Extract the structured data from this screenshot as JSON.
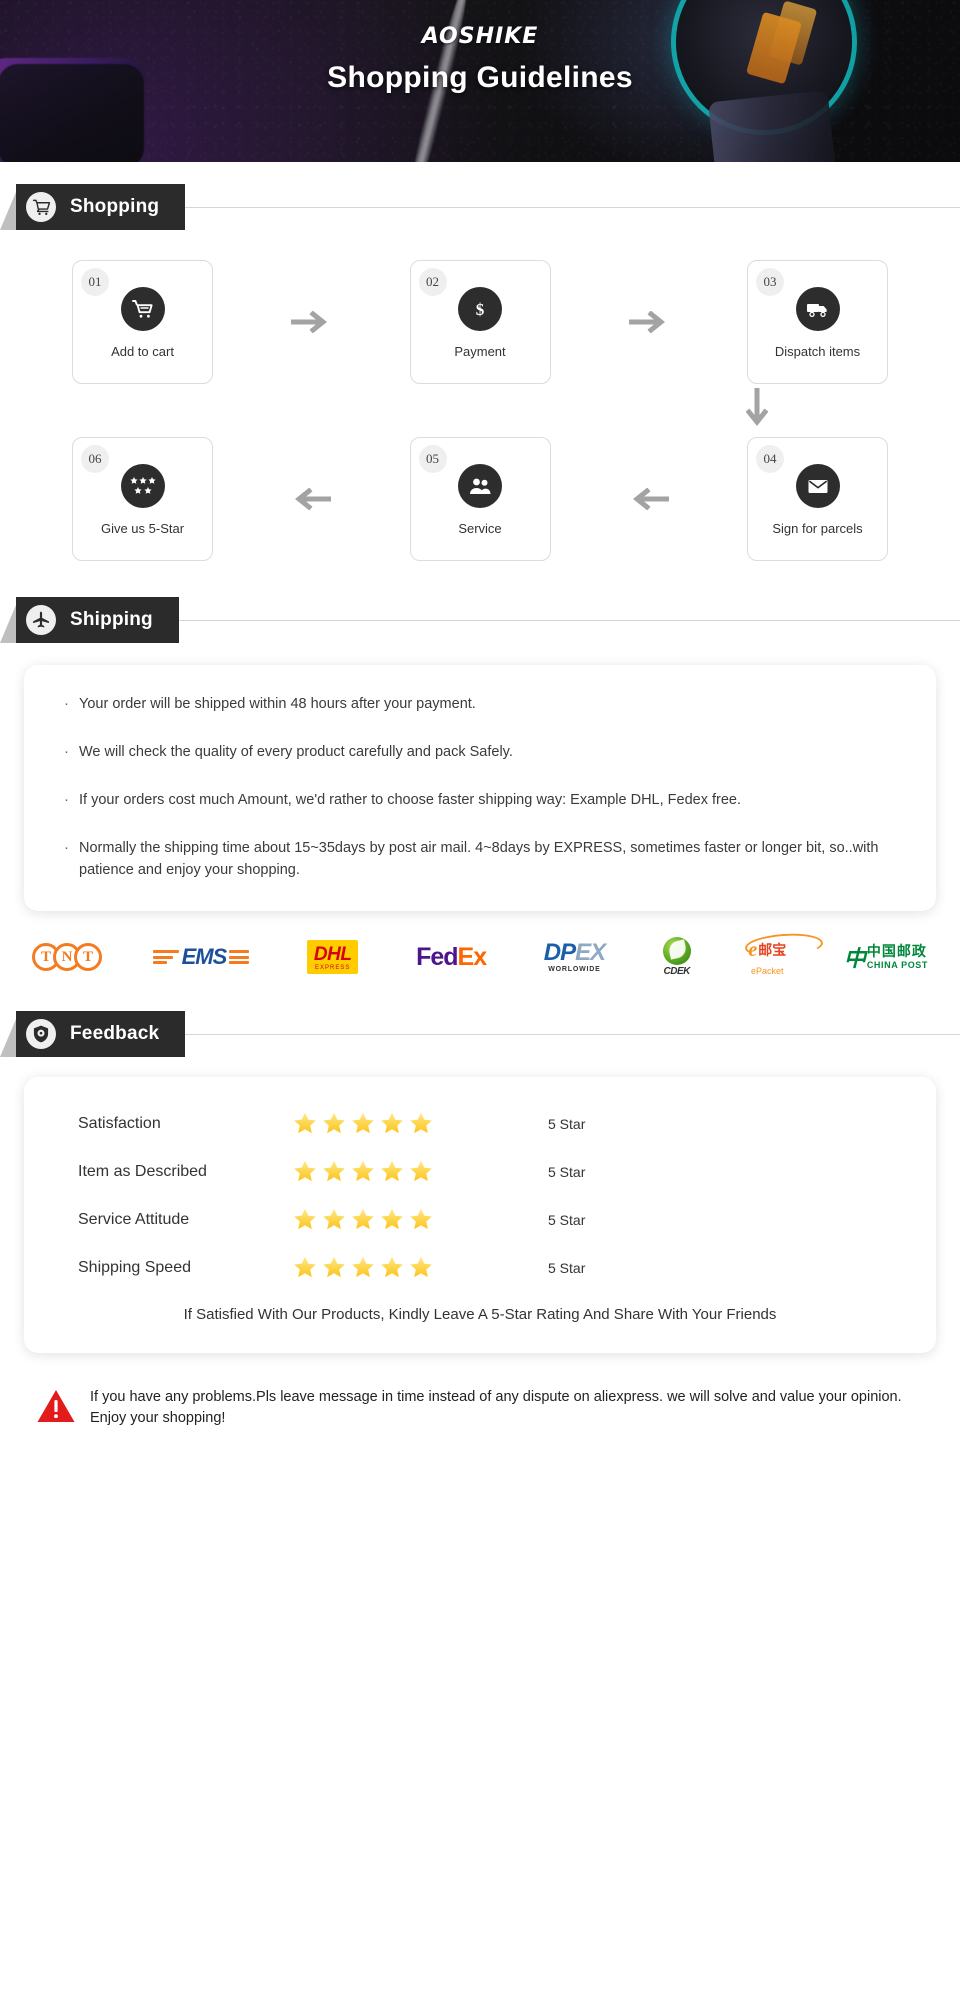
{
  "hero": {
    "brand": "AOSHIKE",
    "title": "Shopping Guidelines"
  },
  "sections": {
    "shopping": {
      "label": "Shopping",
      "icon": "shopping-cart-icon"
    },
    "shipping": {
      "label": "Shipping",
      "icon": "airplane-icon"
    },
    "feedback": {
      "label": "Feedback",
      "icon": "shield-icon"
    }
  },
  "steps": {
    "row1": [
      {
        "num": "01",
        "label": "Add to cart",
        "icon": "cart-icon"
      },
      {
        "num": "02",
        "label": "Payment",
        "icon": "dollar-icon"
      },
      {
        "num": "03",
        "label": "Dispatch items",
        "icon": "truck-icon"
      }
    ],
    "row2": [
      {
        "num": "06",
        "label": "Give us 5-Star",
        "icon": "stars-icon"
      },
      {
        "num": "05",
        "label": "Service",
        "icon": "people-icon"
      },
      {
        "num": "04",
        "label": "Sign for parcels",
        "icon": "envelope-icon"
      }
    ],
    "arrow_right": "→",
    "arrow_left": "←",
    "arrow_down": "↓"
  },
  "shipping_notes": [
    "Your order will be shipped within 48 hours after your payment.",
    "We will check the quality of every product carefully and pack Safely.",
    "If your orders cost much Amount, we'd rather to choose faster shipping way: Example DHL, Fedex free.",
    "Normally the shipping time about 15~35days by post air mail. 4~8days by EXPRESS, sometimes faster or longer bit, so..with patience and enjoy your shopping."
  ],
  "carriers": [
    {
      "name": "TNT",
      "letters": [
        "T",
        "N",
        "T"
      ]
    },
    {
      "name": "EMS",
      "text": "EMS"
    },
    {
      "name": "DHL",
      "text": "DHL",
      "sub": "EXPRESS"
    },
    {
      "name": "FedEx",
      "part1": "Fed",
      "part2": "Ex"
    },
    {
      "name": "DPEX",
      "part1": "DP",
      "part2": "EX",
      "sub": "WORLOWIDE"
    },
    {
      "name": "CDEK",
      "text": "CDEK"
    },
    {
      "name": "ePacket",
      "mark": "e",
      "cn": "邮宝",
      "sub": "ePacket"
    },
    {
      "name": "China Post",
      "cn": "中国邮政",
      "en": "CHINA  POST"
    }
  ],
  "feedback": {
    "rows": [
      {
        "name": "Satisfaction",
        "stars": 5,
        "value": "5 Star"
      },
      {
        "name": "Item as Described",
        "stars": 5,
        "value": "5 Star"
      },
      {
        "name": "Service Attitude",
        "stars": 5,
        "value": "5 Star"
      },
      {
        "name": "Shipping Speed",
        "stars": 5,
        "value": "5 Star"
      }
    ],
    "note": "If Satisfied With Our Products, Kindly Leave A 5-Star Rating And Share With Your Friends"
  },
  "footer": {
    "icon": "warning-triangle-icon",
    "text": "If you have any problems.Pls leave message in time instead of any dispute on aliexpress. we will solve and value your opinion. Enjoy your shopping!"
  },
  "colors": {
    "banner_bg": "#2b2b2b",
    "icon_circle": "#2d2d2d",
    "star": "#ffd34e",
    "warning": "#e21b1b"
  }
}
